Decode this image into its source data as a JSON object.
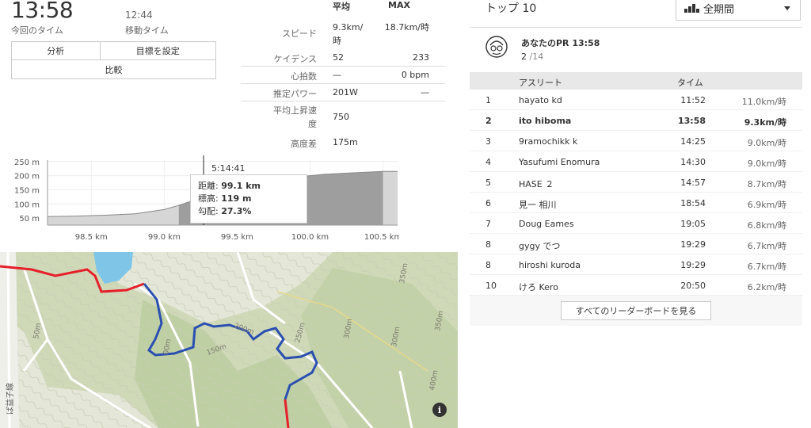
{
  "summary": {
    "elapsed_time": "13:58",
    "elapsed_label": "今回のタイム",
    "moving_time": "12:44",
    "moving_label": "移動タイム"
  },
  "actions": {
    "analysis": "分析",
    "set_goal": "目標を設定",
    "compare": "比較"
  },
  "stats": {
    "header_avg": "平均",
    "header_max": "MAX",
    "rows": [
      {
        "label": "スピード",
        "avg": "9.3km/時",
        "max": "18.7km/時"
      },
      {
        "label": "ケイデンス",
        "avg": "52",
        "max": "233"
      },
      {
        "label": "心拍数",
        "avg": "—",
        "max": "0 bpm"
      },
      {
        "label": "推定パワー",
        "avg": "201W",
        "max": "—"
      },
      {
        "label": "平均上昇速度",
        "avg": "750",
        "max": ""
      },
      {
        "label": "高度差",
        "avg": "175m",
        "max": ""
      }
    ]
  },
  "chart_data": {
    "type": "area",
    "x": [
      98.2,
      98.4,
      98.6,
      98.8,
      99.0,
      99.1,
      99.3,
      99.5,
      99.7,
      99.9,
      100.1,
      100.3,
      100.5,
      100.6
    ],
    "y": [
      55,
      57,
      60,
      65,
      80,
      95,
      130,
      150,
      170,
      195,
      205,
      210,
      215,
      215
    ],
    "segment_range": [
      99.1,
      100.5
    ],
    "xlabel": "",
    "ylabel": "",
    "xticks": [
      "98.5 km",
      "99.0 km",
      "99.5 km",
      "100.0 km",
      "100.5 km"
    ],
    "yticks": [
      "250 m",
      "200 m",
      "150 m",
      "100 m",
      "50 m"
    ],
    "xlim": [
      98.2,
      100.6
    ],
    "ylim": [
      25,
      255
    ],
    "cursor": {
      "time": "5:14:41",
      "distance_label": "距離:",
      "distance": "99.1 km",
      "elevation_label": "標高:",
      "elevation": "119 m",
      "grade_label": "勾配:",
      "grade": "27.3%"
    }
  },
  "map": {
    "info_button": "i",
    "contour_labels": [
      "350m",
      "350m",
      "300m",
      "300m",
      "250m",
      "200m",
      "150m",
      "400m",
      "50m",
      "00m"
    ],
    "road_label": "ば益子線"
  },
  "leaderboard": {
    "title": "トップ 10",
    "period": "全期間",
    "pr_label": "あなたのPR 13:58",
    "pr_rank": "2",
    "pr_total": "/14",
    "col_athlete": "アスリート",
    "col_time": "タイム",
    "rows": [
      {
        "rank": "1",
        "name": "hayato kd",
        "time": "11:52",
        "speed": "11.0km/時",
        "me": false
      },
      {
        "rank": "2",
        "name": "ito hiboma",
        "time": "13:58",
        "speed": "9.3km/時",
        "me": true
      },
      {
        "rank": "3",
        "name": "9ramochikk k",
        "time": "14:25",
        "speed": "9.0km/時",
        "me": false
      },
      {
        "rank": "4",
        "name": "Yasufumi Enomura",
        "time": "14:30",
        "speed": "9.0km/時",
        "me": false
      },
      {
        "rank": "5",
        "name": "HASE ２",
        "time": "14:57",
        "speed": "8.7km/時",
        "me": false
      },
      {
        "rank": "6",
        "name": "見一 相川",
        "time": "18:54",
        "speed": "6.9km/時",
        "me": false
      },
      {
        "rank": "7",
        "name": "Doug Eames",
        "time": "19:05",
        "speed": "6.8km/時",
        "me": false
      },
      {
        "rank": "8",
        "name": "gygy でつ",
        "time": "19:29",
        "speed": "6.7km/時",
        "me": false
      },
      {
        "rank": "8",
        "name": "hiroshi kuroda",
        "time": "19:29",
        "speed": "6.7km/時",
        "me": false
      },
      {
        "rank": "10",
        "name": "けろ Kero",
        "time": "20:50",
        "speed": "6.2km/時",
        "me": false
      }
    ],
    "view_all": "すべてのリーダーボードを見る"
  }
}
